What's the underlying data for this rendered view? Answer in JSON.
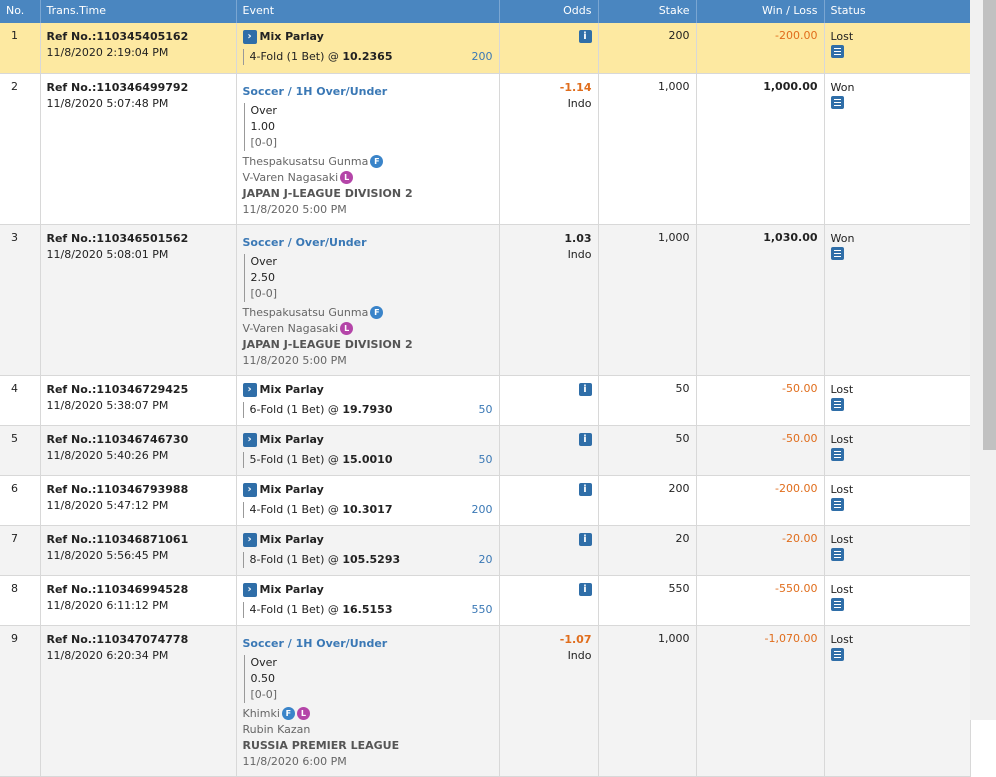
{
  "headers": {
    "no": "No.",
    "time": "Trans.Time",
    "event": "Event",
    "odds": "Odds",
    "stake": "Stake",
    "winloss": "Win / Loss",
    "status": "Status"
  },
  "rows": [
    {
      "no": "1",
      "ref": "Ref No.:110345405162",
      "time": "11/8/2020 2:19:04 PM",
      "type": "parlay",
      "title": "Mix Parlay",
      "fold": "4-Fold (1 Bet)",
      "at": "@",
      "odds": "10.2365",
      "amount": "200",
      "stake": "200",
      "winloss": "-200.00",
      "status": "Lost"
    },
    {
      "no": "2",
      "ref": "Ref No.:110346499792",
      "time": "11/8/2020 5:07:48 PM",
      "type": "single",
      "sport": "Soccer / 1H Over/Under",
      "pick": "Over",
      "line": "1.00",
      "score": "[0-0]",
      "home": "Thespakusatsu Gunma",
      "away": "V-Varen Nagasaki",
      "league": "JAPAN J-LEAGUE DIVISION 2",
      "kickoff": "11/8/2020 5:00 PM",
      "odds": "-1.14",
      "odds_type": "Indo",
      "stake": "1,000",
      "winloss": "1,000.00",
      "status": "Won"
    },
    {
      "no": "3",
      "ref": "Ref No.:110346501562",
      "time": "11/8/2020 5:08:01 PM",
      "type": "single",
      "sport": "Soccer / Over/Under",
      "pick": "Over",
      "line": "2.50",
      "score": "[0-0]",
      "home": "Thespakusatsu Gunma",
      "away": "V-Varen Nagasaki",
      "league": "JAPAN J-LEAGUE DIVISION 2",
      "kickoff": "11/8/2020 5:00 PM",
      "odds": "1.03",
      "odds_type": "Indo",
      "stake": "1,000",
      "winloss": "1,030.00",
      "status": "Won"
    },
    {
      "no": "4",
      "ref": "Ref No.:110346729425",
      "time": "11/8/2020 5:38:07 PM",
      "type": "parlay",
      "title": "Mix Parlay",
      "fold": "6-Fold (1 Bet)",
      "at": "@",
      "odds": "19.7930",
      "amount": "50",
      "stake": "50",
      "winloss": "-50.00",
      "status": "Lost"
    },
    {
      "no": "5",
      "ref": "Ref No.:110346746730",
      "time": "11/8/2020 5:40:26 PM",
      "type": "parlay",
      "title": "Mix Parlay",
      "fold": "5-Fold (1 Bet)",
      "at": "@",
      "odds": "15.0010",
      "amount": "50",
      "stake": "50",
      "winloss": "-50.00",
      "status": "Lost"
    },
    {
      "no": "6",
      "ref": "Ref No.:110346793988",
      "time": "11/8/2020 5:47:12 PM",
      "type": "parlay",
      "title": "Mix Parlay",
      "fold": "4-Fold (1 Bet)",
      "at": "@",
      "odds": "10.3017",
      "amount": "200",
      "stake": "200",
      "winloss": "-200.00",
      "status": "Lost"
    },
    {
      "no": "7",
      "ref": "Ref No.:110346871061",
      "time": "11/8/2020 5:56:45 PM",
      "type": "parlay",
      "title": "Mix Parlay",
      "fold": "8-Fold (1 Bet)",
      "at": "@",
      "odds": "105.5293",
      "amount": "20",
      "stake": "20",
      "winloss": "-20.00",
      "status": "Lost"
    },
    {
      "no": "8",
      "ref": "Ref No.:110346994528",
      "time": "11/8/2020 6:11:12 PM",
      "type": "parlay",
      "title": "Mix Parlay",
      "fold": "4-Fold (1 Bet)",
      "at": "@",
      "odds": "16.5153",
      "amount": "550",
      "stake": "550",
      "winloss": "-550.00",
      "status": "Lost"
    },
    {
      "no": "9",
      "ref": "Ref No.:110347074778",
      "time": "11/8/2020 6:20:34 PM",
      "type": "single",
      "sport": "Soccer / 1H Over/Under",
      "pick": "Over",
      "line": "0.50",
      "score": "[0-0]",
      "home": "Khimki",
      "away": "Rubin Kazan",
      "league": "RUSSIA PREMIER LEAGUE",
      "kickoff": "11/8/2020 6:00 PM",
      "odds": "-1.07",
      "odds_type": "Indo",
      "stake": "1,000",
      "winloss": "-1,070.00",
      "status": "Lost"
    }
  ],
  "icons": {
    "info": "i",
    "badge_f": "F",
    "badge_l": "L",
    "arrow": "›"
  },
  "colors": {
    "header": "#4a86c0",
    "highlight": "#fde9a1",
    "negative": "#e06d1c",
    "link": "#3a78b5"
  }
}
